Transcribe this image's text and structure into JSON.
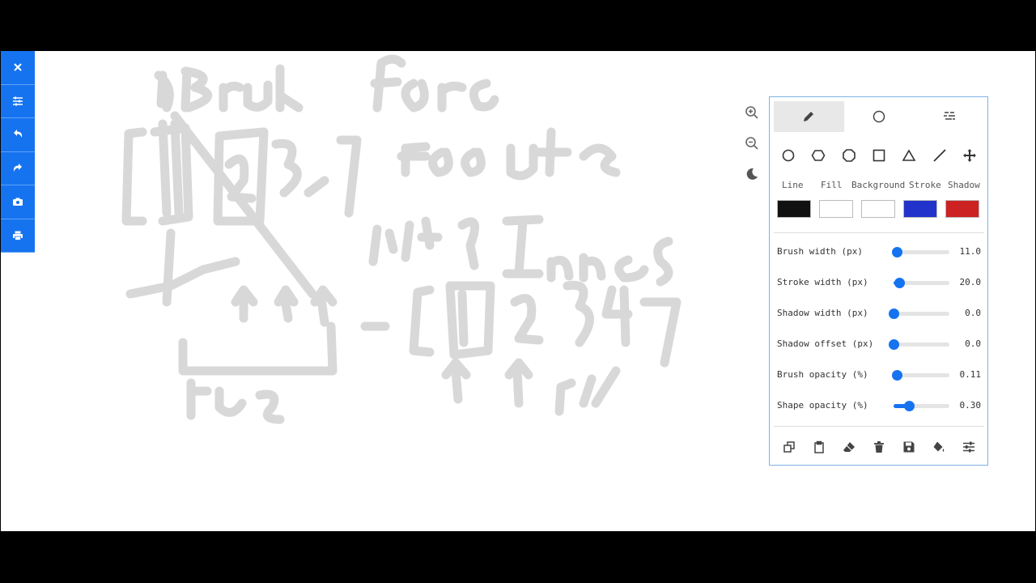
{
  "labels": {
    "line": "Line",
    "fill": "Fill",
    "background": "Background",
    "stroke": "Stroke",
    "shadow": "Shadow"
  },
  "colors": {
    "accent": "#1673f0",
    "line": "#111111",
    "fill": "#ffffff",
    "background": "#ffffff",
    "stroke": "#2233cc",
    "shadow": "#cc2222",
    "drawing": "#d8d8d8"
  },
  "sliders": [
    {
      "label": "Brush width (px)",
      "value": "11.0",
      "fraction": 0.06
    },
    {
      "label": "Stroke width (px)",
      "value": "20.0",
      "fraction": 0.1
    },
    {
      "label": "Shadow width (px)",
      "value": "0.0",
      "fraction": 0.0
    },
    {
      "label": "Shadow offset (px)",
      "value": "0.0",
      "fraction": 0.0
    },
    {
      "label": "Brush opacity (%)",
      "value": "0.11",
      "fraction": 0.06
    },
    {
      "label": "Shape opacity (%)",
      "value": "0.30",
      "fraction": 0.27
    }
  ],
  "icons": {
    "left_toolbar": [
      "close-icon",
      "settings-sliders-icon",
      "undo-icon",
      "redo-icon",
      "camera-icon",
      "print-icon"
    ],
    "zoom": [
      "zoom-in-icon",
      "zoom-out-icon",
      "moon-icon"
    ],
    "tabs": [
      "pencil-icon",
      "circle-icon",
      "brush-lines-icon"
    ],
    "shapes": [
      "circle-icon",
      "hexagon-icon",
      "octagon-icon",
      "square-icon",
      "triangle-icon",
      "line-icon",
      "move-icon"
    ],
    "actions": [
      "copy-icon",
      "paste-icon",
      "eraser-icon",
      "trash-icon",
      "save-icon",
      "paint-bucket-icon",
      "settings-sliders-icon"
    ]
  }
}
